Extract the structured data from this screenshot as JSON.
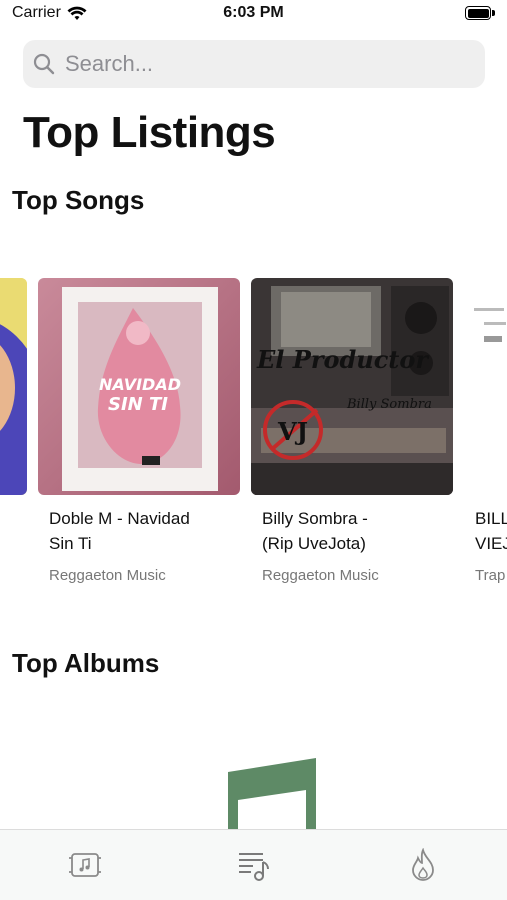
{
  "status_bar": {
    "carrier": "Carrier",
    "time": "6:03 PM"
  },
  "search": {
    "placeholder": "Search..."
  },
  "page_title": "Top Listings",
  "sections": {
    "songs_title": "Top Songs",
    "albums_title": "Top Albums"
  },
  "songs": [
    {
      "name": "",
      "genre": ""
    },
    {
      "name": "Doble M - Navidad\nSin Ti",
      "genre": "Reggaeton Music",
      "cover_text": "NAVIDAD SIN TI"
    },
    {
      "name": "Billy Sombra -\n(Rip UveJota)",
      "genre": "Reggaeton Music",
      "cover_text": "El Productor",
      "cover_subtext": "Billy Sombra",
      "cover_badge": "VJ"
    },
    {
      "name": "BILLY\nVIEJ",
      "genre": "Trap"
    }
  ],
  "tabs": [
    {
      "icon": "album-icon"
    },
    {
      "icon": "playlist-icon"
    },
    {
      "icon": "flame-icon"
    }
  ],
  "colors": {
    "accent_green": "#5e8a66",
    "card_pink": "#e9a6b8",
    "studio_dark": "#3d3a3a"
  }
}
